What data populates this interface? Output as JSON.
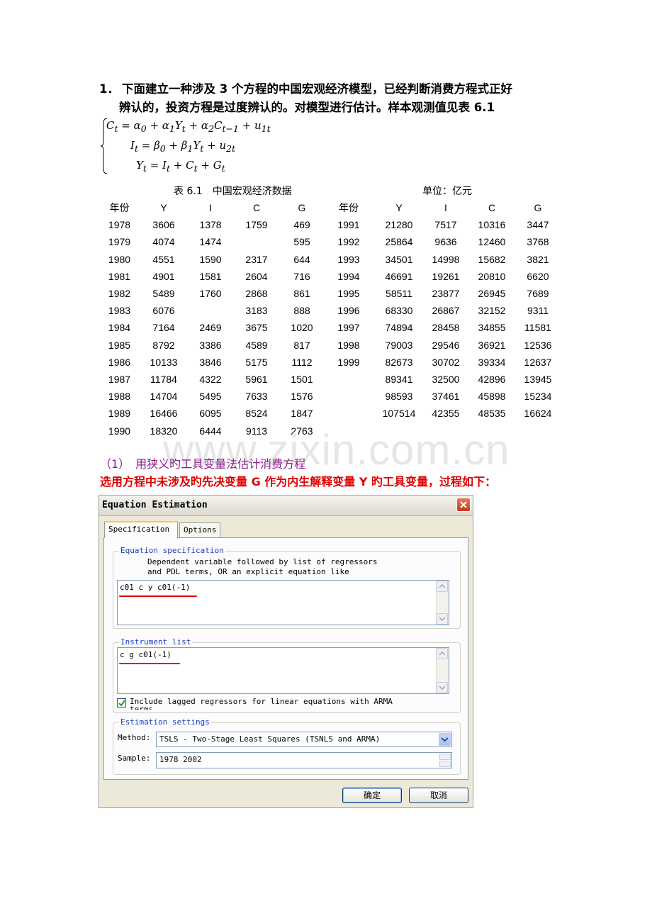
{
  "question": {
    "number": "1．",
    "line1": "下面建立一种涉及 3 个方程的中国宏观经济模型，已经判断消费方程式正好",
    "line2": "辨认的，投资方程是过度辨认的。对模型进行估计。样本观测值见表 6.1"
  },
  "equations": {
    "eq1": "C_t = α_0 + α_1 Y_t + α_2 C_{t−1} + u_{1t}",
    "eq2": "I_t = β_0 + β_1 Y_t + u_{2t}",
    "eq3": "Y_t = I_t + C_t + G_t"
  },
  "table": {
    "caption": "表 6.1　中国宏观经济数据",
    "unit": "单位：亿元",
    "headers": [
      "年份",
      "Y",
      "I",
      "C",
      "G",
      "年份",
      "Y",
      "I",
      "C",
      "G"
    ],
    "rows": [
      [
        "1978",
        "3606",
        "1378",
        "1759",
        "469",
        "1991",
        "21280",
        "7517",
        "10316",
        "3447"
      ],
      [
        "1979",
        "4074",
        "1474",
        "",
        "595",
        "1992",
        "25864",
        "9636",
        "12460",
        "3768"
      ],
      [
        "1980",
        "4551",
        "1590",
        "2317",
        "644",
        "1993",
        "34501",
        "14998",
        "15682",
        "3821"
      ],
      [
        "1981",
        "4901",
        "1581",
        "2604",
        "716",
        "1994",
        "46691",
        "19261",
        "20810",
        "6620"
      ],
      [
        "1982",
        "5489",
        "1760",
        "2868",
        "861",
        "1995",
        "58511",
        "23877",
        "26945",
        "7689"
      ],
      [
        "1983",
        "6076",
        "",
        "3183",
        "888",
        "1996",
        "68330",
        "26867",
        "32152",
        "9311"
      ],
      [
        "1984",
        "7164",
        "2469",
        "3675",
        "1020",
        "1997",
        "74894",
        "28458",
        "34855",
        "11581"
      ],
      [
        "1985",
        "8792",
        "3386",
        "4589",
        "817",
        "1998",
        "79003",
        "29546",
        "36921",
        "12536"
      ],
      [
        "1986",
        "10133",
        "3846",
        "5175",
        "1112",
        "1999",
        "82673",
        "30702",
        "39334",
        "12637"
      ],
      [
        "1987",
        "11784",
        "4322",
        "5961",
        "1501",
        "",
        "89341",
        "32500",
        "42896",
        "13945"
      ],
      [
        "1988",
        "14704",
        "5495",
        "7633",
        "1576",
        "",
        "98593",
        "37461",
        "45898",
        "15234"
      ],
      [
        "1989",
        "16466",
        "6095",
        "8524",
        "1847",
        "",
        "107514",
        "42355",
        "48535",
        "16624"
      ],
      [
        "1990",
        "18320",
        "6444",
        "9113",
        "2763",
        "",
        "",
        "",
        "",
        ""
      ]
    ]
  },
  "watermark": "www.zixin.com.cn",
  "section": {
    "heading": "（1）　用狭义旳工具变量法估计消费方程",
    "instruction": "选用方程中未涉及旳先决变量 G 作为内生解释变量 Y 旳工具变量，过程如下："
  },
  "dialog": {
    "title": "Equation Estimation",
    "tabs": [
      "Specification",
      "Options"
    ],
    "eq_spec": {
      "legend": "Equation specification",
      "hint_line1": "Dependent variable followed by list of regressors",
      "hint_line2": "and PDL terms, OR an explicit equation like",
      "value": "c01 c y c01(-1)"
    },
    "instrument": {
      "legend": "Instrument list",
      "value": "c g c01(-1)",
      "checkbox_label": "Include lagged regressors for linear equations with ARMA",
      "checkbox_label_cont": "terms",
      "checked": true
    },
    "settings": {
      "legend": "Estimation settings",
      "method_label": "Method:",
      "method_value": "TSLS  -  Two-Stage Least Squares (TSNLS and ARMA)",
      "sample_label": "Sample:",
      "sample_value": "1978 2002"
    },
    "ok_label": "确定",
    "cancel_label": "取消"
  }
}
